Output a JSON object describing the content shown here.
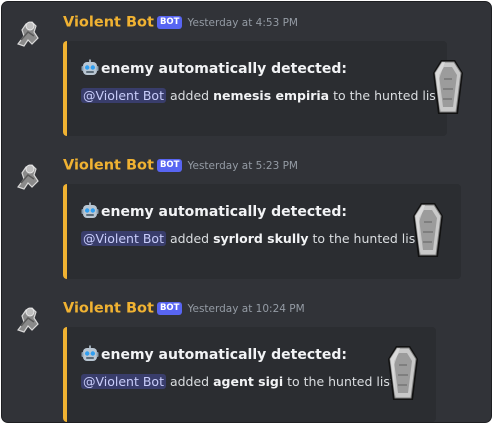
{
  "messages": [
    {
      "username": "Violent Bot",
      "badge": "BOT",
      "timestamp": "Yesterday at 4:53 PM",
      "embed": {
        "title": "enemy automatically detected:",
        "mention": "@Violent Bot",
        "text_before": " added ",
        "target": "nemesis empiria",
        "text_after": " to the hunted list."
      }
    },
    {
      "username": "Violent Bot",
      "badge": "BOT",
      "timestamp": "Yesterday at 5:23 PM",
      "embed": {
        "title": "enemy automatically detected:",
        "mention": "@Violent Bot",
        "text_before": " added ",
        "target": "syrlord skully",
        "text_after": " to the hunted list."
      }
    },
    {
      "username": "Violent Bot",
      "badge": "BOT",
      "timestamp": "Yesterday at 10:24 PM",
      "embed": {
        "title": "enemy automatically detected:",
        "mention": "@Violent Bot",
        "text_before": " added ",
        "target": "agent sigi",
        "text_after": " to the hunted list."
      }
    }
  ],
  "colors": {
    "background": "#313338",
    "embed_background": "#2b2d31",
    "embed_accent": "#f0b232",
    "username": "#f0b232",
    "bot_badge": "#5865f2",
    "timestamp": "#949ba4",
    "mention_text": "#c9cdfb"
  },
  "icons": {
    "avatar": "warrior-avatar-icon",
    "title_emoji": "robot-emoji-icon",
    "thumbnail": "coffin-icon"
  }
}
